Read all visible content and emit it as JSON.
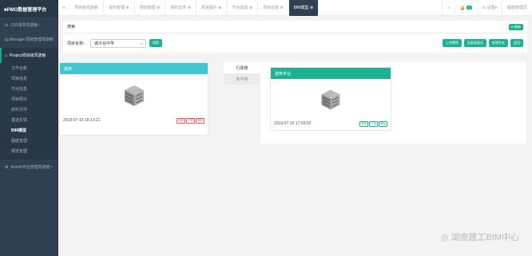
{
  "brand": "■PMO数据管理平台",
  "sidebar": {
    "groups": [
      {
        "label": "CIO领导驾驶舱 ‹"
      },
      {
        "label": "Manager项目管理驾驶舱"
      }
    ],
    "active_group": "Project项目级驾驶舱",
    "sub_items": [
      "工作台账",
      "项目信息",
      "节点信息",
      "项目照片",
      "资料文件",
      "报送反馈",
      "BIM模型",
      "图纸管理",
      "报批管理"
    ],
    "last_group": "Admin平台管理驾驶舱 ‹"
  },
  "tabs": [
    "项目级驾驶舱",
    "资料管理 ⊗",
    "规划管理 ⊗",
    "资料文件 ⊗",
    "项目图片 ⊗",
    "节点信息 ⊗",
    "项目信息 ⊗",
    "BIM模型 ⊗"
  ],
  "topbar_right": {
    "notify_count": "1",
    "settings": "☑ 设置▾",
    "user": "超级管理员"
  },
  "panel": {
    "title": "搜索",
    "refresh": "⟳ 刷新",
    "project_label": "项目名称：",
    "project_value": "城子台中学",
    "search_btn": "搜索",
    "actions": [
      "上传模型",
      "发起轻量化",
      "新增专业",
      "返回"
    ]
  },
  "cards": [
    {
      "title": "建筑",
      "date": "2019-07-15 18:13:21",
      "buttons": [
        "查看",
        "下载",
        "删除"
      ]
    },
    {
      "title": "建筑专业",
      "date": "2019-07-15 17:59:52",
      "buttons": [
        "查看",
        "上传",
        "删除"
      ]
    }
  ],
  "side_tabs": [
    "行政楼",
    "教学楼"
  ],
  "watermark": "湖南建工BIM中心"
}
